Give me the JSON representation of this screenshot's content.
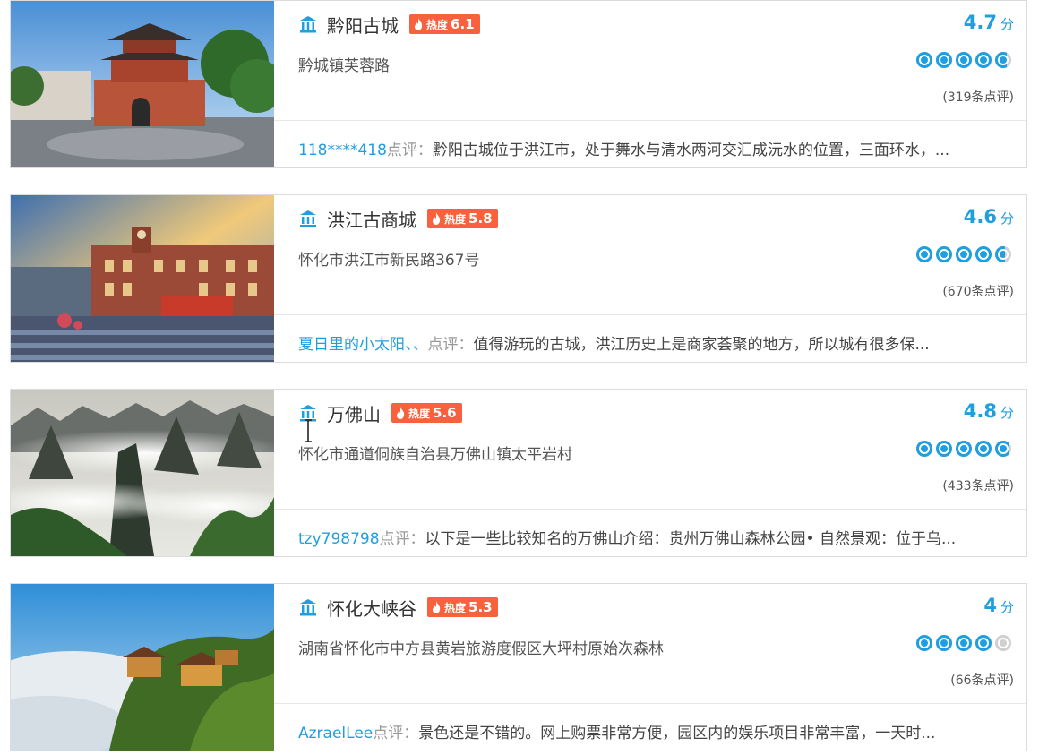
{
  "colors": {
    "accent": "#1f9fe0",
    "hot_badge": "#f7613d",
    "card_border": "#dcdcdc"
  },
  "icons": {
    "name_icon": "landmark-icon",
    "hot_icon": "flame-icon",
    "rating_icon": "rating-circle-icon"
  },
  "hot_label": "热度",
  "score_unit": "分",
  "comment_label": "点评：",
  "attractions": [
    {
      "name": "黔阳古城",
      "hot_score": "6.1",
      "address": "黔城镇芙蓉路",
      "score": "4.7",
      "rating": 4.7,
      "review_count": "(319条点评)",
      "comment_user": "118****418",
      "comment_text": "黔阳古城位于洪江市，处于舞水与清水两河交汇成沅水的位置，三面环水，..."
    },
    {
      "name": "洪江古商城",
      "hot_score": "5.8",
      "address": "怀化市洪江市新民路367号",
      "score": "4.6",
      "rating": 4.6,
      "review_count": "(670条点评)",
      "comment_user": "夏日里的小太阳、、",
      "comment_text": "值得游玩的古城，洪江历史上是商家荟聚的地方，所以城有很多保..."
    },
    {
      "name": "万佛山",
      "hot_score": "5.6",
      "address": "怀化市通道侗族自治县万佛山镇太平岩村",
      "score": "4.8",
      "rating": 4.8,
      "review_count": "(433条点评)",
      "comment_user": "tzy798798",
      "comment_text": "以下是一些比较知名的万佛山介绍：贵州万佛山森林公园• 自然景观：位于乌..."
    },
    {
      "name": "怀化大峡谷",
      "hot_score": "5.3",
      "address": "湖南省怀化市中方县黄岩旅游度假区大坪村原始次森林",
      "score": "4",
      "rating": 4.0,
      "review_count": "(66条点评)",
      "comment_user": "AzraelLee",
      "comment_text": "景色还是不错的。网上购票非常方便，园区内的娱乐项目非常丰富，一天时..."
    }
  ]
}
